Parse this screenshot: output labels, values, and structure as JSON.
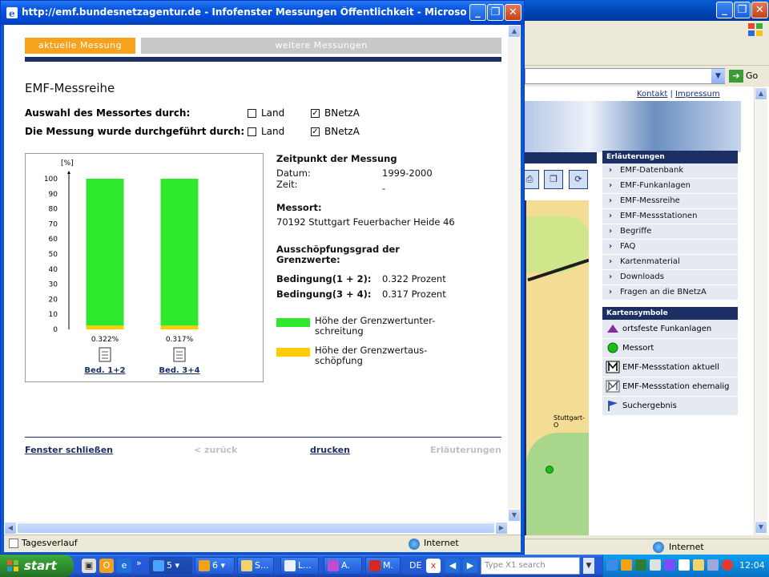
{
  "background_window": {
    "top_links": [
      "Kontakt",
      "Impressum"
    ],
    "address_value": "",
    "go_label": "Go",
    "sidebar_header": "Erläuterungen",
    "sidebar_items": [
      "EMF-Datenbank",
      "EMF-Funkanlagen",
      "EMF-Messreihe",
      "EMF-Messstationen",
      "Begriffe",
      "FAQ",
      "Kartenmaterial",
      "Downloads",
      "Fragen an die BNetzA"
    ],
    "symbols_header": "Kartensymbole",
    "symbols": [
      {
        "label": "ortsfeste Funkanlagen",
        "icon": "purple-triangle-icon"
      },
      {
        "label": "Messort",
        "icon": "green-dot-icon"
      },
      {
        "label": "EMF-Messstation aktuell",
        "icon": "station-active-icon"
      },
      {
        "label": "EMF-Messstation ehemalig",
        "icon": "station-former-icon"
      },
      {
        "label": "Suchergebnis",
        "icon": "blue-flag-icon"
      }
    ],
    "map_label": "Stuttgart-O",
    "status_zone": "Internet"
  },
  "popup": {
    "title": "http://emf.bundesnetzagentur.de - Infofenster Messungen Öffentlichkeit - Microsoft Internet ...",
    "tabs": {
      "current": "aktuelle Messung",
      "more": "weitere Messungen"
    },
    "heading": "EMF-Messreihe",
    "selection": {
      "row1_label": "Auswahl des Messortes durch:",
      "row2_label": "Die Messung wurde durchgeführt durch:",
      "opt_land": "Land",
      "opt_bnetza": "BNetzA",
      "row1_land_checked": false,
      "row1_bnetza_checked": true,
      "row2_land_checked": false,
      "row2_bnetza_checked": true,
      "check_mark": "✓"
    },
    "info": {
      "time_title": "Zeitpunkt der Messung",
      "date_label": "Datum:",
      "date_value": "1999-2000",
      "time_label": "Zeit:",
      "time_value": "-",
      "place_title": "Messort:",
      "place_value": "70192 Stuttgart Feuerbacher Heide 46",
      "degree_title_1": "Ausschöpfungsgrad der",
      "degree_title_2": "Grenzwerte:",
      "cond1_label": "Bedingung(1 + 2):",
      "cond1_value": "0.322 Prozent",
      "cond2_label": "Bedingung(3 + 4):",
      "cond2_value": "0.317 Prozent"
    },
    "legend": [
      {
        "color": "#2ee82e",
        "line1": "Höhe der Grenzwertunter-",
        "line2": "schreitung"
      },
      {
        "color": "#ffcc00",
        "line1": "Höhe der Grenzwertaus-",
        "line2": "schöpfung"
      }
    ],
    "nav": {
      "close": "Fenster schließen",
      "back": "< zurück",
      "print": "drucken",
      "explain": "Erläuterungen"
    },
    "status_left": "Tagesverlauf",
    "status_zone": "Internet"
  },
  "chart_data": {
    "type": "bar",
    "stacked": true,
    "ylabel": "[%]",
    "ylim": [
      0,
      100
    ],
    "yticks": [
      0,
      10,
      20,
      30,
      40,
      50,
      60,
      70,
      80,
      90,
      100
    ],
    "categories": [
      "Bed. 1+2",
      "Bed. 3+4"
    ],
    "bar_labels": [
      "0.322%",
      "0.317%"
    ],
    "series": [
      {
        "name": "Höhe der Grenzwertaus-schöpfung",
        "color": "#ffcc00",
        "values": [
          2.5,
          2.5
        ]
      },
      {
        "name": "Höhe der Grenzwertunter-schreitung",
        "color": "#2ee82e",
        "values": [
          97.5,
          97.5
        ]
      }
    ]
  },
  "taskbar": {
    "start_label": "start",
    "tasks": [
      {
        "label": "5",
        "icon": "ie-icon"
      },
      {
        "label": "6",
        "icon": "outlook-icon"
      },
      {
        "label": "S...",
        "icon": "folder-icon"
      },
      {
        "label": "L...",
        "icon": "word-icon"
      },
      {
        "label": "A.",
        "icon": "app-icon"
      },
      {
        "label": "M.",
        "icon": "acrobat-icon"
      }
    ],
    "lang": "DE",
    "search_placeholder": "Type X1 search",
    "clock": "12:04"
  }
}
